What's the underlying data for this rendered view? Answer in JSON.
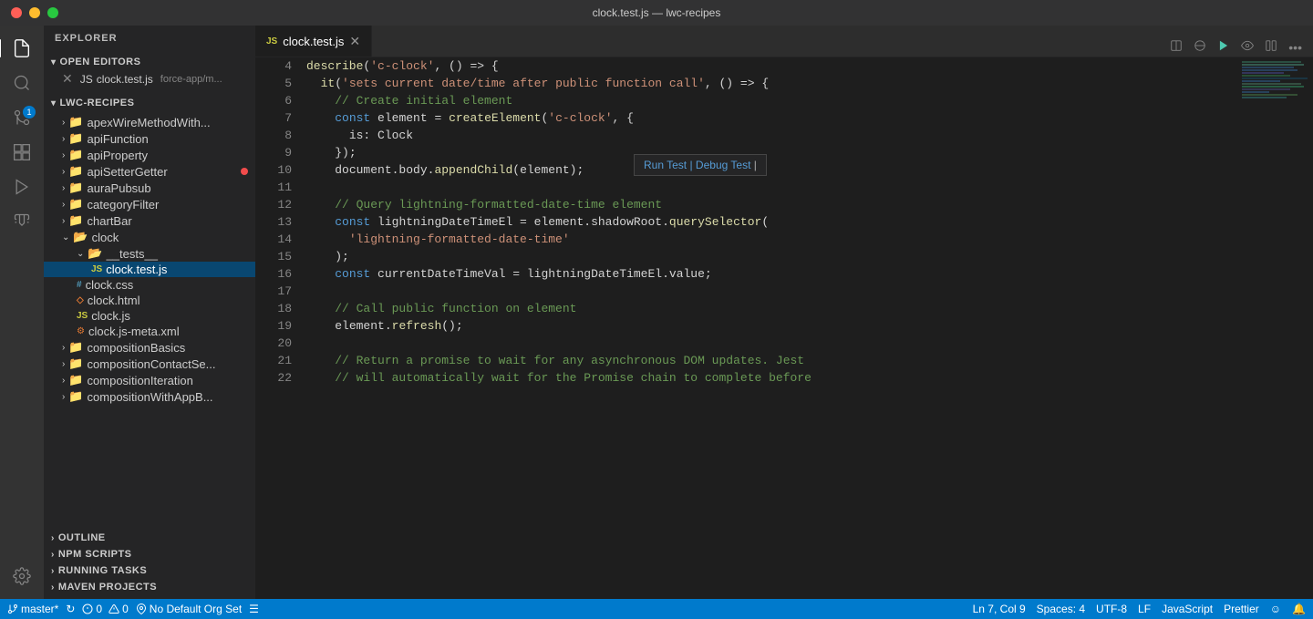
{
  "titlebar": {
    "title": "clock.test.js — lwc-recipes",
    "traffic": [
      "close",
      "minimize",
      "maximize"
    ]
  },
  "activity_bar": {
    "icons": [
      {
        "name": "explorer",
        "glyph": "⧉",
        "active": true
      },
      {
        "name": "search",
        "glyph": "🔍"
      },
      {
        "name": "source-control",
        "glyph": "⎇",
        "badge": "1"
      },
      {
        "name": "extensions",
        "glyph": "⊞"
      },
      {
        "name": "run",
        "glyph": "▶"
      },
      {
        "name": "test",
        "glyph": "⚗"
      }
    ],
    "bottom_icons": [
      {
        "name": "settings",
        "glyph": "⚙"
      }
    ]
  },
  "sidebar": {
    "header": "EXPLORER",
    "open_editors_label": "OPEN EDITORS",
    "open_editors": [
      {
        "filename": "clock.test.js",
        "path": "force-app/m...",
        "icon": "js",
        "modified": false,
        "active": true
      }
    ],
    "lwc_recipes_label": "LWC-RECIPES",
    "tree": [
      {
        "label": "apexWireMethodWith...",
        "type": "folder",
        "indent": 1,
        "collapsed": true
      },
      {
        "label": "apiFunction",
        "type": "folder",
        "indent": 1,
        "collapsed": true
      },
      {
        "label": "apiProperty",
        "type": "folder",
        "indent": 1,
        "collapsed": true
      },
      {
        "label": "apiSetterGetter",
        "type": "folder",
        "indent": 1,
        "collapsed": true,
        "red_dot": true
      },
      {
        "label": "auraPubsub",
        "type": "folder",
        "indent": 1,
        "collapsed": true
      },
      {
        "label": "categoryFilter",
        "type": "folder",
        "indent": 1,
        "collapsed": true
      },
      {
        "label": "chartBar",
        "type": "folder",
        "indent": 1,
        "collapsed": true
      },
      {
        "label": "clock",
        "type": "folder",
        "indent": 1,
        "collapsed": false
      },
      {
        "label": "__tests__",
        "type": "folder",
        "indent": 2,
        "collapsed": false
      },
      {
        "label": "clock.test.js",
        "type": "js",
        "indent": 3,
        "active": true
      },
      {
        "label": "clock.css",
        "type": "css",
        "indent": 2
      },
      {
        "label": "clock.html",
        "type": "html",
        "indent": 2
      },
      {
        "label": "clock.js",
        "type": "js",
        "indent": 2
      },
      {
        "label": "clock.js-meta.xml",
        "type": "xml",
        "indent": 2
      },
      {
        "label": "compositionBasics",
        "type": "folder",
        "indent": 1,
        "collapsed": true
      },
      {
        "label": "compositionContactSe...",
        "type": "folder",
        "indent": 1,
        "collapsed": true
      },
      {
        "label": "compositionIteration",
        "type": "folder",
        "indent": 1,
        "collapsed": true
      },
      {
        "label": "compositionWithAppB...",
        "type": "folder",
        "indent": 1,
        "collapsed": true
      }
    ],
    "bottom_sections": [
      {
        "label": "OUTLINE",
        "collapsed": true
      },
      {
        "label": "NPM SCRIPTS",
        "collapsed": true
      },
      {
        "label": "RUNNING TASKS",
        "collapsed": true
      },
      {
        "label": "MAVEN PROJECTS",
        "collapsed": true
      }
    ]
  },
  "editor": {
    "tab_label": "clock.test.js",
    "tab_icon": "js",
    "run_test_popup": "Run Test | Debug Test",
    "lines": [
      {
        "num": 4,
        "content": [
          {
            "t": "fn",
            "v": "describe"
          },
          {
            "t": "punc",
            "v": "("
          },
          {
            "t": "str",
            "v": "'c-clock'"
          },
          {
            "t": "punc",
            "v": ", () => {"
          }
        ]
      },
      {
        "num": 5,
        "content": [
          {
            "t": "fn",
            "v": "  it"
          },
          {
            "t": "punc",
            "v": "("
          },
          {
            "t": "str",
            "v": "'sets current date/time after public function call'"
          },
          {
            "t": "punc",
            "v": ", () => {"
          }
        ]
      },
      {
        "num": 6,
        "content": [
          {
            "t": "cmt",
            "v": "    // Create initial element"
          }
        ]
      },
      {
        "num": 7,
        "content": [
          {
            "t": "punc",
            "v": "    "
          },
          {
            "t": "kw",
            "v": "const"
          },
          {
            "t": "punc",
            "v": " element = "
          },
          {
            "t": "fn",
            "v": "createElement"
          },
          {
            "t": "punc",
            "v": "("
          },
          {
            "t": "str",
            "v": "'c-clock'"
          },
          {
            "t": "punc",
            "v": ", {"
          }
        ]
      },
      {
        "num": 8,
        "content": [
          {
            "t": "punc",
            "v": "      is: Clock"
          }
        ]
      },
      {
        "num": 9,
        "content": [
          {
            "t": "punc",
            "v": "    });"
          }
        ]
      },
      {
        "num": 10,
        "content": [
          {
            "t": "punc",
            "v": "    document.body."
          },
          {
            "t": "fn",
            "v": "appendChild"
          },
          {
            "t": "punc",
            "v": "(element);"
          }
        ]
      },
      {
        "num": 11,
        "content": []
      },
      {
        "num": 12,
        "content": [
          {
            "t": "cmt",
            "v": "    // Query lightning-formatted-date-time element"
          }
        ]
      },
      {
        "num": 13,
        "content": [
          {
            "t": "punc",
            "v": "    "
          },
          {
            "t": "kw",
            "v": "const"
          },
          {
            "t": "punc",
            "v": " lightningDateTimeEl = element.shadowRoot."
          },
          {
            "t": "fn",
            "v": "querySelector"
          },
          {
            "t": "punc",
            "v": "("
          }
        ]
      },
      {
        "num": 14,
        "content": [
          {
            "t": "str",
            "v": "      'lightning-formatted-date-time'"
          }
        ]
      },
      {
        "num": 15,
        "content": [
          {
            "t": "punc",
            "v": "    );"
          }
        ]
      },
      {
        "num": 16,
        "content": [
          {
            "t": "punc",
            "v": "    "
          },
          {
            "t": "kw",
            "v": "const"
          },
          {
            "t": "punc",
            "v": " currentDateTimeVal = lightningDateTimeEl.value;"
          }
        ]
      },
      {
        "num": 17,
        "content": []
      },
      {
        "num": 18,
        "content": [
          {
            "t": "cmt",
            "v": "    // Call public function on element"
          }
        ]
      },
      {
        "num": 19,
        "content": [
          {
            "t": "punc",
            "v": "    element."
          },
          {
            "t": "fn",
            "v": "refresh"
          },
          {
            "t": "punc",
            "v": "();"
          }
        ]
      },
      {
        "num": 20,
        "content": []
      },
      {
        "num": 21,
        "content": [
          {
            "t": "cmt",
            "v": "    // Return a promise to wait for any asynchronous DOM updates. Jest"
          }
        ]
      },
      {
        "num": 22,
        "content": [
          {
            "t": "cmt",
            "v": "    // will automatically wait for the Promise chain to complete before"
          }
        ]
      }
    ]
  },
  "status_bar": {
    "branch": "master*",
    "sync_icon": "↻",
    "errors": "0",
    "warnings": "0",
    "no_default_org": "No Default Org Set",
    "menu_icon": "☰",
    "position": "Ln 7, Col 9",
    "spaces": "Spaces: 4",
    "encoding": "UTF-8",
    "eol": "LF",
    "language": "JavaScript",
    "formatter": "Prettier",
    "smiley": "☺",
    "bell": "🔔"
  }
}
